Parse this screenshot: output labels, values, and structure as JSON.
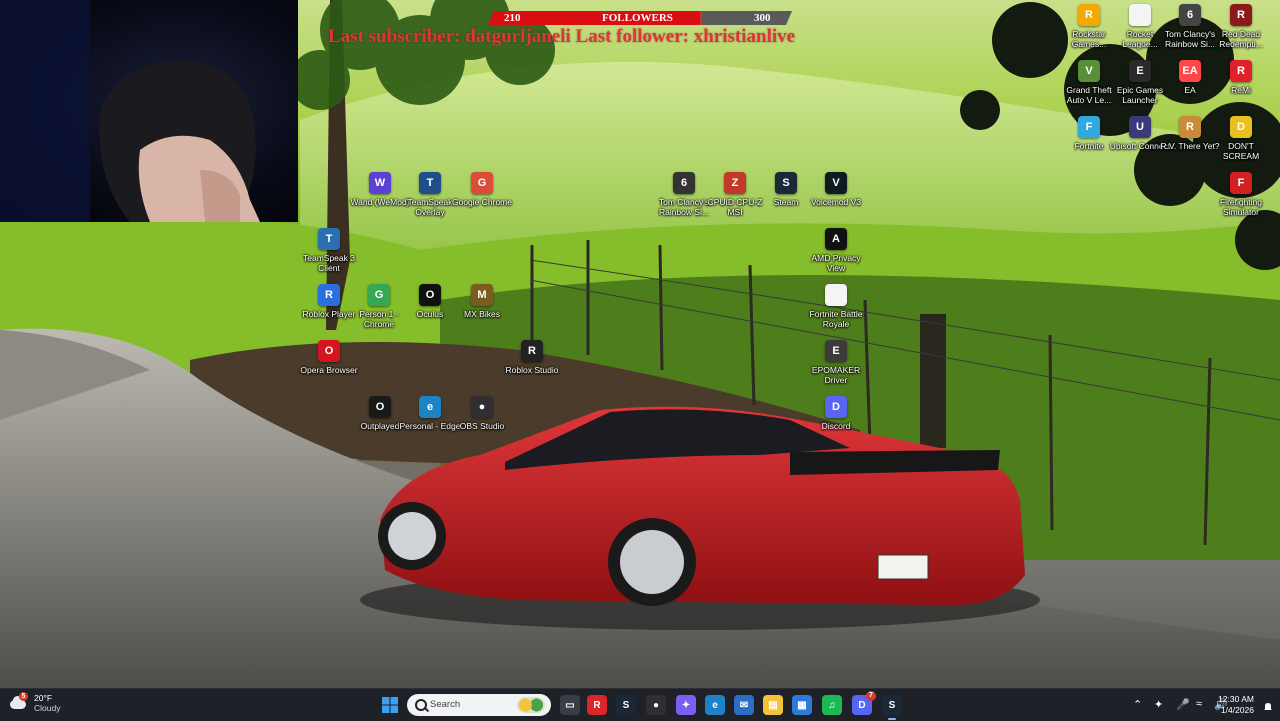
{
  "overlay": {
    "followers_current": "210",
    "followers_label": "FOLLOWERS",
    "followers_goal": "300",
    "followers_progress": 0.7,
    "subscriber_line": "Last subscriber: datgurljaneli Last follower: xhristianlive"
  },
  "desktop_icons": [
    {
      "label": "Wand (WeMod)",
      "icon": "wand-icon",
      "color": "#5b3fd6"
    },
    {
      "label": "TeamSpeak Overlay",
      "icon": "teamspeak-icon",
      "color": "#1f4e8a"
    },
    {
      "label": "Google Chrome",
      "icon": "chrome-icon",
      "color": "#dd4b39"
    },
    {
      "label": "Tom Clancy's Rainbow Si...",
      "icon": "rainbow-six-icon",
      "color": "#333333"
    },
    {
      "label": "CPUID CPU-Z MSI",
      "icon": "cpuz-icon",
      "color": "#c0392b"
    },
    {
      "label": "Steam",
      "icon": "steam-icon",
      "color": "#1b2838"
    },
    {
      "label": "Voicemod V3",
      "icon": "voicemod-icon",
      "color": "#0e1b1f"
    },
    {
      "label": "TeamSpeak 3 Client",
      "icon": "teamspeak3-icon",
      "color": "#2a6fb0"
    },
    {
      "label": "AMD Privacy View",
      "icon": "amd-privacy-icon",
      "color": "#111111"
    },
    {
      "label": "Roblox Player",
      "icon": "roblox-player-icon",
      "color": "#2b6fde"
    },
    {
      "label": "Person 1 - Chrome",
      "icon": "chrome-profile-icon",
      "color": "#34a853"
    },
    {
      "label": "Oculus",
      "icon": "oculus-icon",
      "color": "#111111"
    },
    {
      "label": "MX Bikes",
      "icon": "mx-bikes-icon",
      "color": "#7a5c1e"
    },
    {
      "label": "Fortnite Battle Royale",
      "icon": "file-icon",
      "color": "#f4f4f4"
    },
    {
      "label": "Opera Browser",
      "icon": "opera-icon",
      "color": "#d6141f"
    },
    {
      "label": "Roblox Studio",
      "icon": "roblox-studio-icon",
      "color": "#222222"
    },
    {
      "label": "EPOMAKER Driver",
      "icon": "epomaker-icon",
      "color": "#3c3c3c"
    },
    {
      "label": "Outplayed",
      "icon": "outplayed-icon",
      "color": "#1a1a1a"
    },
    {
      "label": "Personal - Edge",
      "icon": "edge-icon",
      "color": "#1c84c6"
    },
    {
      "label": "OBS Studio",
      "icon": "obs-icon",
      "color": "#302e31"
    },
    {
      "label": "Discord",
      "icon": "discord-icon",
      "color": "#5865f2"
    },
    {
      "label": "Rockstar Games...",
      "icon": "rockstar-icon",
      "color": "#f2a900"
    },
    {
      "label": "Rocket League...",
      "icon": "rocket-league-icon",
      "color": "#f4f4f4"
    },
    {
      "label": "Tom Clancy's Rainbow Si...",
      "icon": "rainbow-six-icon",
      "color": "#444444"
    },
    {
      "label": "Red Dead Redempti...",
      "icon": "red-dead-icon",
      "color": "#8b1a1a"
    },
    {
      "label": "Grand Theft Auto V Le...",
      "icon": "gta-icon",
      "color": "#5a8f3a"
    },
    {
      "label": "Epic Games Launcher",
      "icon": "epic-games-icon",
      "color": "#2a2a2a"
    },
    {
      "label": "EA",
      "icon": "ea-icon",
      "color": "#ff4747"
    },
    {
      "label": "ReMi",
      "icon": "remi-icon",
      "color": "#e0202a"
    },
    {
      "label": "Fortnite",
      "icon": "fortnite-icon",
      "color": "#30a8e0"
    },
    {
      "label": "Ubisoft Connect",
      "icon": "ubisoft-icon",
      "color": "#3a3a7a"
    },
    {
      "label": "R.V. There Yet?",
      "icon": "rv-there-yet-icon",
      "color": "#c98b3a"
    },
    {
      "label": "DON'T SCREAM",
      "icon": "dont-scream-icon",
      "color": "#e8c020"
    },
    {
      "label": "Firefighting Simulator",
      "icon": "firefighting-icon",
      "color": "#d32020"
    }
  ],
  "taskbar": {
    "weather_temp": "20°F",
    "weather_desc": "Cloudy",
    "weather_badge": "5",
    "search_placeholder": "Search",
    "discord_badge": "7",
    "time": "12:30 AM",
    "date": "1/4/2026",
    "pinned": [
      {
        "name": "task-view-icon",
        "color": "#3a3d45"
      },
      {
        "name": "app-red-icon",
        "color": "#d9262b"
      },
      {
        "name": "steam-taskbar-icon",
        "color": "#1b2838"
      },
      {
        "name": "obs-taskbar-icon",
        "color": "#302e31"
      },
      {
        "name": "copilot-icon",
        "color": "#7b5ff0"
      },
      {
        "name": "edge-taskbar-icon",
        "color": "#1c84c6"
      },
      {
        "name": "mail-icon",
        "color": "#2b6cc4"
      },
      {
        "name": "file-explorer-icon",
        "color": "#f3c23a"
      },
      {
        "name": "store-icon",
        "color": "#2f7ad8"
      },
      {
        "name": "spotify-icon",
        "color": "#1db954"
      },
      {
        "name": "discord-taskbar-icon",
        "color": "#5865f2"
      },
      {
        "name": "steam-active-icon",
        "color": "#1b2838"
      }
    ]
  }
}
